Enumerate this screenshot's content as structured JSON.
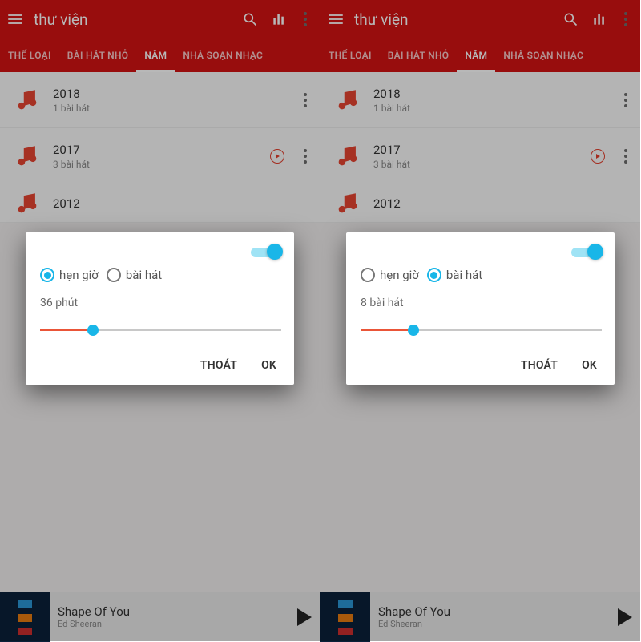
{
  "screens": [
    {
      "header": {
        "title": "thư viện"
      },
      "tabs": [
        "THỂ LOẠI",
        "BÀI HÁT NHỎ",
        "NĂM",
        "NHÀ SOẠN NHẠC"
      ],
      "active_tab": 2,
      "rows": [
        {
          "title": "2018",
          "sub": "1 bài hát",
          "has_play": false
        },
        {
          "title": "2017",
          "sub": "3 bài hát",
          "has_play": true
        },
        {
          "title": "2012",
          "sub": "",
          "has_play": false
        }
      ],
      "now_playing": {
        "title": "Shape Of You",
        "artist": "Ed Sheeran"
      },
      "dialog": {
        "toggle_on": true,
        "radio_labels": [
          "hẹn giờ",
          "bài hát"
        ],
        "radio_selected": 0,
        "value_text": "36 phút",
        "slider_percent": 22,
        "cancel": "THOÁT",
        "ok": "OK"
      }
    },
    {
      "header": {
        "title": "thư viện"
      },
      "tabs": [
        "THỂ LOẠI",
        "BÀI HÁT NHỎ",
        "NĂM",
        "NHÀ SOẠN NHẠC"
      ],
      "active_tab": 2,
      "rows": [
        {
          "title": "2018",
          "sub": "1 bài hát",
          "has_play": false
        },
        {
          "title": "2017",
          "sub": "3 bài hát",
          "has_play": true
        },
        {
          "title": "2012",
          "sub": "",
          "has_play": false
        }
      ],
      "now_playing": {
        "title": "Shape Of You",
        "artist": "Ed Sheeran"
      },
      "dialog": {
        "toggle_on": true,
        "radio_labels": [
          "hẹn giờ",
          "bài hát"
        ],
        "radio_selected": 1,
        "value_text": "8 bài hát",
        "slider_percent": 22,
        "cancel": "THOÁT",
        "ok": "OK"
      }
    }
  ],
  "colors": {
    "brand": "#d31313",
    "accent": "#19b6e8",
    "slider": "#ea5538"
  }
}
